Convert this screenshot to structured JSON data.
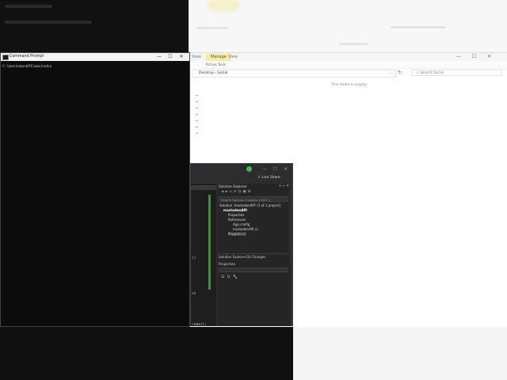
{
  "command_prompt": {
    "title": "Command Prompt",
    "prompt_line": "C:\\mastodonAPI\\mastodon",
    "controls": [
      "—",
      "☐",
      "✕"
    ]
  },
  "explorer": {
    "manage_tab": "Manage",
    "view_tab": "View",
    "menu_left": "View",
    "picture_tools": "Picture Tools",
    "breadcrumb": "Desktop  ›  Social",
    "search_placeholder": "Search Social",
    "empty_message": "This folder is empty.",
    "controls": [
      "—",
      "☐",
      "✕"
    ]
  },
  "visual_studio": {
    "live_share": "Live Share",
    "solution_explorer": {
      "title": "Solution Explorer",
      "search_placeholder": "Search Solution Explorer (Ctrl+;)",
      "items": [
        "Solution 'mastodonAPI' (1 of 1 project)",
        "mastodonAPI",
        "Properties",
        "References",
        "App.config",
        "mastodonAPI.cs",
        "Program.cs"
      ]
    },
    "bottom_tabs": [
      "Solution Explorer",
      "Git Changes"
    ],
    "properties_title": "Properties",
    "code_fragments": [
      "()",
      "ct",
      "rode();"
    ],
    "controls": [
      "—",
      "☐",
      "✕"
    ]
  },
  "colors": {
    "terminal_bg": "#0c0c0c",
    "vs_bg": "#2d2d30",
    "manage_highlight": "#f6eb9e",
    "vs_indicator": "#3fbf3f"
  }
}
